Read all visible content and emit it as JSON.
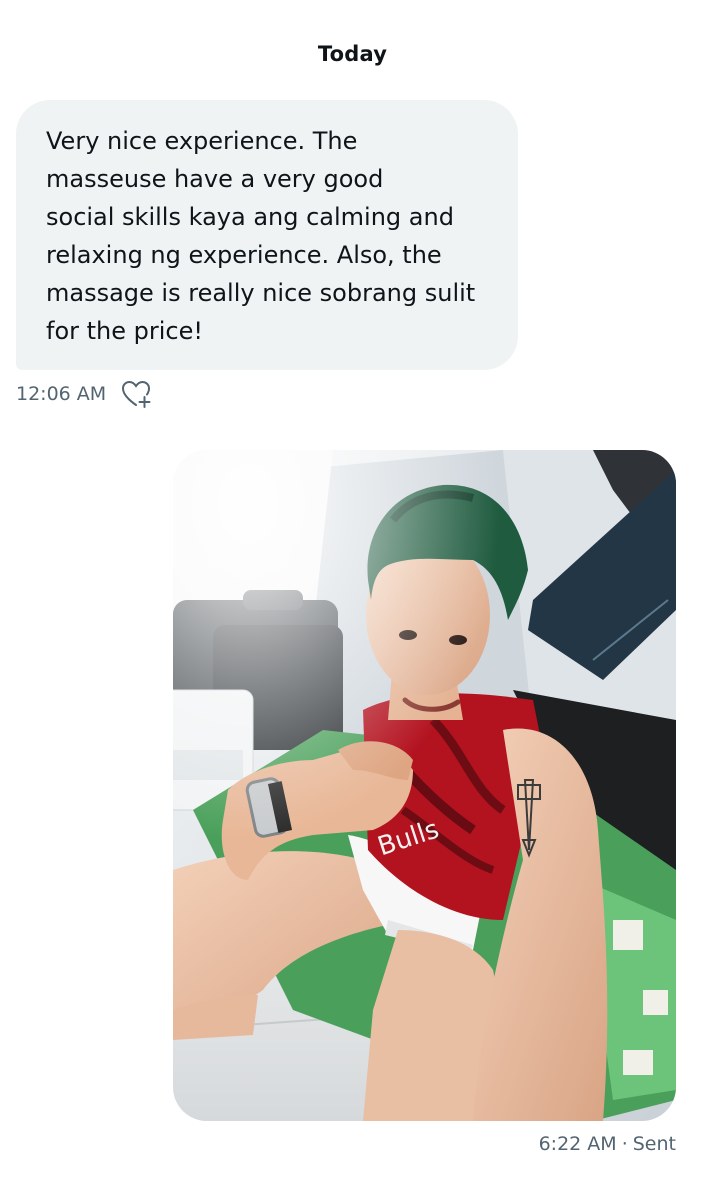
{
  "conversation": {
    "date_divider": "Today",
    "received_message": {
      "lines": [
        "Very nice experience. The",
        "masseuse have a very good",
        "social skills kaya ang calming and",
        "relaxing ng experience. Also, the",
        "massage is really nice sobrang sulit",
        "for the price!"
      ],
      "time": "12:06 AM",
      "reaction_icon": "heart-plus-icon"
    },
    "sent_message": {
      "attachment_type": "photo",
      "time": "6:22 AM",
      "separator": "·",
      "status": "Sent"
    }
  },
  "colors": {
    "received_bubble": "#eff3f4",
    "primary_text": "#0f1419",
    "secondary_text": "#536471"
  }
}
